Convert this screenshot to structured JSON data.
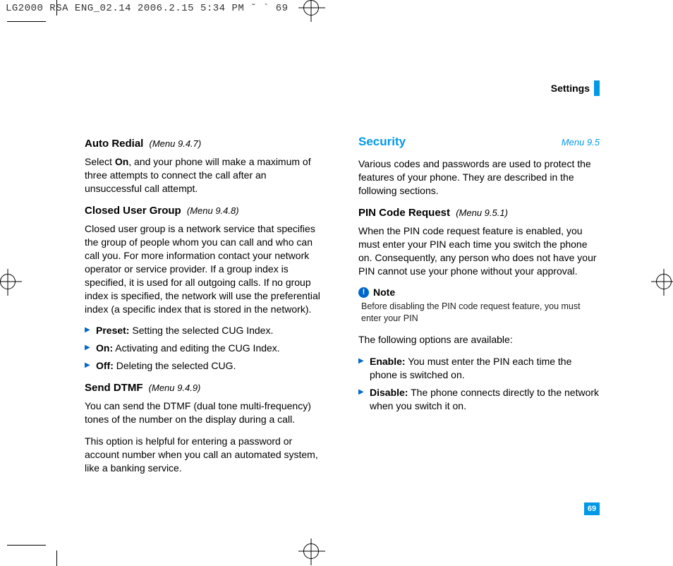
{
  "print_header": "LG2000 RSA ENG_02.14  2006.2.15 5:34 PM  ˘ ` 69",
  "section_label": "Settings",
  "page_number": "69",
  "left": {
    "auto_redial": {
      "title": "Auto Redial",
      "menu": "(Menu 9.4.7)",
      "body_pre": "Select ",
      "body_bold": "On",
      "body_post": ", and your phone will make a maximum of three attempts to connect the call after an unsuccessful call attempt."
    },
    "cug": {
      "title": "Closed User Group",
      "menu": "(Menu 9.4.8)",
      "body": "Closed user group is a network service that specifies the group of people whom you can call and who can call you. For more information contact your network operator or service provider. If a group index is specified, it is used for all outgoing calls. If no group index is specified, the network will use the preferential index (a specific index that is stored in the network).",
      "items": [
        {
          "label": "Preset:",
          "text": " Setting the selected CUG Index."
        },
        {
          "label": "On:",
          "text": " Activating and editing the CUG Index."
        },
        {
          "label": "Off:",
          "text": " Deleting the selected CUG."
        }
      ]
    },
    "dtmf": {
      "title": "Send DTMF",
      "menu": "(Menu 9.4.9)",
      "body1": "You can send the DTMF (dual tone multi-frequency) tones of the number on the display during a call.",
      "body2": "This option is helpful for entering a password or account number when you call an automated system, like a banking service."
    }
  },
  "right": {
    "security": {
      "title": "Security",
      "menu": "Menu 9.5",
      "intro": "Various codes and passwords are used to protect the features of your phone. They are described in the following sections."
    },
    "pin": {
      "title": "PIN Code Request",
      "menu": "(Menu 9.5.1)",
      "body": "When the PIN code request feature is enabled, you must enter your PIN each time you switch the phone on. Consequently, any person who does not have your PIN cannot use your phone without your approval."
    },
    "note": {
      "label": "Note",
      "body": "Before disabling the PIN code request feature, you must enter your PIN"
    },
    "options_intro": "The following options are available:",
    "options": [
      {
        "label": "Enable:",
        "text": " You must enter the PIN each time the phone is switched on."
      },
      {
        "label": "Disable:",
        "text": " The phone connects directly to the network when you switch it on."
      }
    ]
  }
}
